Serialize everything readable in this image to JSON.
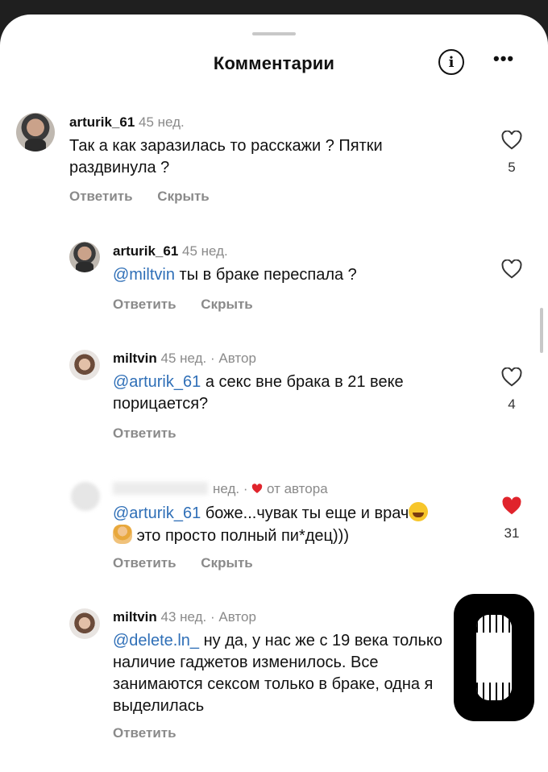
{
  "header": {
    "title": "Комментарии",
    "info_icon": "info-circle-icon",
    "more_icon": "more-horizontal-icon",
    "more_glyph": "•••"
  },
  "actions": {
    "reply": "Ответить",
    "hide": "Скрыть"
  },
  "comments": [
    {
      "username": "arturik_61",
      "time": "45 нед.",
      "author_tag": "",
      "mention": "",
      "text": "Так а как заразилась то расскажи ? Пятки раздвинула ?",
      "likes": "5",
      "liked": false,
      "show_hide": true
    },
    {
      "username": "arturik_61",
      "time": "45 нед.",
      "author_tag": "",
      "mention": "@miltvin",
      "text": "ты в браке переспала ?",
      "likes": "",
      "liked": false,
      "show_hide": true
    },
    {
      "username": "miltvin",
      "time": "45 нед.",
      "author_tag": "· Автор",
      "mention": "@arturik_61",
      "text": "а секс вне брака в 21 веке порицается?",
      "likes": "4",
      "liked": false,
      "show_hide": false
    },
    {
      "username": "",
      "time": "нед.",
      "author_tag": "· ",
      "from_author": "от автора",
      "mention": "@arturik_61",
      "text": "боже...чувак ты еще и врач",
      "text2": "это просто полный пи*дец)))",
      "likes": "31",
      "liked": true,
      "show_hide": true
    },
    {
      "username": "miltvin",
      "time": "43 нед.",
      "author_tag": "· Автор",
      "mention": "@delete.ln_",
      "text": "ну да, у нас же с 19 века только наличие гаджетов изменилось. Все занимаются сексом только в браке, одна я выделилась",
      "likes": "",
      "liked": false,
      "show_hide": false
    }
  ],
  "colors": {
    "mention": "#2f6fb7",
    "like_red": "#e0242c",
    "meta_gray": "#8a8a8a"
  }
}
